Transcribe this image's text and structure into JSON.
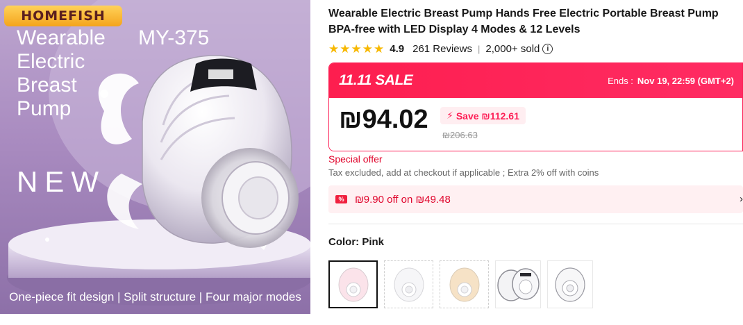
{
  "product_image": {
    "brand": "HOMEFISH",
    "title": "Wearable Electric Breast Pump",
    "model": "MY-375",
    "new_label": "NEW",
    "caption": "One-piece fit design | Split structure | Four major modes"
  },
  "product": {
    "title": "Wearable Electric Breast Pump Hands Free Electric Portable Breast Pump BPA-free with LED Display 4 Modes & 12 Levels",
    "rating": "4.9",
    "stars": 5,
    "reviews": "261 Reviews",
    "divider": "|",
    "sold": "2,000+ sold",
    "info_icon": "info-circle-icon"
  },
  "sale": {
    "label": "11.11 SALE",
    "ends_label": "Ends :",
    "ends_value": "Nov 19, 22:59 (GMT+2)",
    "price": "₪94.02",
    "save": "Save ₪112.61",
    "original_price": "₪206.63"
  },
  "offer": {
    "special": "Special offer",
    "tax": "Tax excluded, add at checkout if applicable ; Extra 2% off with coins"
  },
  "coupon": {
    "icon_text": "%",
    "text": "₪9.90 off on ₪49.48",
    "chevron": "›"
  },
  "color": {
    "label": "Color: Pink",
    "options": [
      "pink",
      "white",
      "beige",
      "double",
      "clear"
    ]
  },
  "colors": {
    "accent": "#fd1f56",
    "star": "#f7b800",
    "hero_bg": "#a98bc0"
  }
}
